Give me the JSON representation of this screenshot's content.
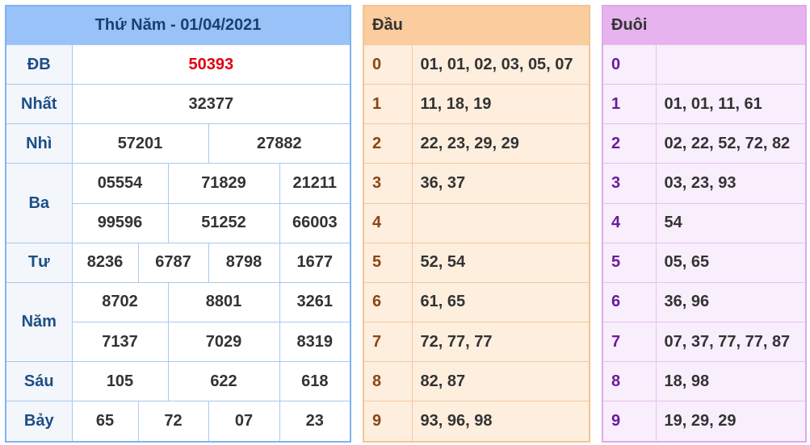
{
  "results": {
    "title": "Thứ Năm - 01/04/2021",
    "db": {
      "label": "ĐB",
      "value": "50393"
    },
    "nhat": {
      "label": "Nhất",
      "value": "32377"
    },
    "nhi": {
      "label": "Nhì",
      "values": [
        "57201",
        "27882"
      ]
    },
    "ba": {
      "label": "Ba",
      "values": [
        "05554",
        "71829",
        "21211",
        "99596",
        "51252",
        "66003"
      ]
    },
    "tu": {
      "label": "Tư",
      "values": [
        "8236",
        "6787",
        "8798",
        "1677"
      ]
    },
    "nam": {
      "label": "Năm",
      "values": [
        "8702",
        "8801",
        "3261",
        "7137",
        "7029",
        "8319"
      ]
    },
    "sau": {
      "label": "Sáu",
      "values": [
        "105",
        "622",
        "618"
      ]
    },
    "bay": {
      "label": "Bảy",
      "values": [
        "65",
        "72",
        "07",
        "23"
      ]
    }
  },
  "head": {
    "title": "Đầu",
    "rows": [
      {
        "digit": "0",
        "numbers": "01, 01, 02, 03, 05, 07"
      },
      {
        "digit": "1",
        "numbers": "11, 18, 19"
      },
      {
        "digit": "2",
        "numbers": "22, 23, 29, 29"
      },
      {
        "digit": "3",
        "numbers": "36, 37"
      },
      {
        "digit": "4",
        "numbers": ""
      },
      {
        "digit": "5",
        "numbers": "52, 54"
      },
      {
        "digit": "6",
        "numbers": "61, 65"
      },
      {
        "digit": "7",
        "numbers": "72, 77, 77"
      },
      {
        "digit": "8",
        "numbers": "82, 87"
      },
      {
        "digit": "9",
        "numbers": "93, 96, 98"
      }
    ]
  },
  "tail": {
    "title": "Đuôi",
    "rows": [
      {
        "digit": "0",
        "numbers": ""
      },
      {
        "digit": "1",
        "numbers": "01, 01, 11, 61"
      },
      {
        "digit": "2",
        "numbers": "02, 22, 52, 72, 82"
      },
      {
        "digit": "3",
        "numbers": "03, 23, 93"
      },
      {
        "digit": "4",
        "numbers": "54"
      },
      {
        "digit": "5",
        "numbers": "05, 65"
      },
      {
        "digit": "6",
        "numbers": "36, 96"
      },
      {
        "digit": "7",
        "numbers": "07, 37, 77, 77, 87"
      },
      {
        "digit": "8",
        "numbers": "18, 98"
      },
      {
        "digit": "9",
        "numbers": "19, 29, 29"
      }
    ]
  }
}
